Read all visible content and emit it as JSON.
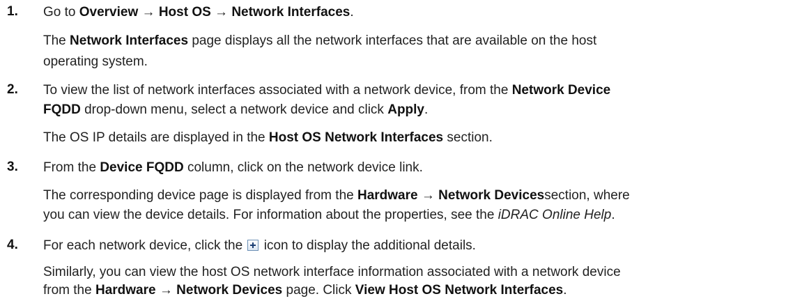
{
  "steps": [
    {
      "number": "1.",
      "instr": {
        "a": "Go to ",
        "b1": "Overview",
        "arrow1": " → ",
        "b2": "Host OS",
        "arrow2": " → ",
        "b3": "Network Interfaces",
        "end": "."
      },
      "result": {
        "a": "The ",
        "b1": "Network Interfaces",
        "c": " page displays all the network interfaces that are available on the host",
        "d": "operating system."
      }
    },
    {
      "number": "2.",
      "instr": {
        "a": "To view the list of network interfaces associated with a network device, from the ",
        "b1": "Network Device",
        "b2": "FQDD",
        "c": " drop-down menu, select a network device and click ",
        "b3": "Apply",
        "end": "."
      },
      "result": {
        "a": "The OS IP details are displayed in the ",
        "b1": "Host OS Network Interfaces",
        "c": " section."
      }
    },
    {
      "number": "3.",
      "instr": {
        "a": "From the ",
        "b1": "Device FQDD",
        "c": " column, click on the network device link."
      },
      "result": {
        "a": "The corresponding device page is displayed from the ",
        "b1": "Hardware",
        "arrow1": " → ",
        "b2": "Network Devices",
        "c": "section, where",
        "d": "you can view the device details. For information about the properties, see the ",
        "i1": "iDRAC Online Help",
        "end": "."
      }
    },
    {
      "number": "4.",
      "instr": {
        "a": "For each network device, click the ",
        "icon": "plus-expand-icon",
        "c": " icon to display the additional details."
      },
      "result": {
        "a": "Similarly, you can view the host OS network interface information associated with a network device",
        "b": "from the ",
        "b1": "Hardware",
        "arrow1": " → ",
        "b2": "Network Devices",
        "c": " page. Click ",
        "b3": "View Host OS Network Interfaces",
        "end": "."
      }
    }
  ]
}
